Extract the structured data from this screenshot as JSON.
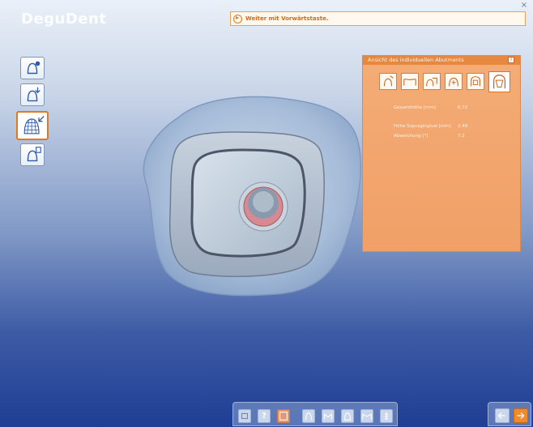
{
  "app": {
    "logo": "DeguDent"
  },
  "hint": {
    "text": "Weiter mit Vorwärtstaste."
  },
  "left_tools": [
    {
      "icon": "crown-info-icon"
    },
    {
      "icon": "crown-down-icon"
    },
    {
      "icon": "crown-mesh-icon",
      "active": true
    },
    {
      "icon": "crown-settings-icon"
    }
  ],
  "panel": {
    "title": "Ansicht des individuellen Abutments",
    "help": "?",
    "views": [
      {
        "icon": "abutment-view-1-icon"
      },
      {
        "icon": "abutment-view-2-icon"
      },
      {
        "icon": "abutment-view-3-icon"
      },
      {
        "icon": "abutment-view-4-icon"
      },
      {
        "icon": "abutment-view-5-icon"
      },
      {
        "icon": "abutment-view-6-icon",
        "active": true
      }
    ],
    "measurements": [
      {
        "label": "Gesamthöhe [mm]",
        "value": "6.72"
      },
      {
        "label": "Höhe Supragingival [mm]",
        "value": "2.49"
      },
      {
        "label": "Abweichung [°]",
        "value": "7.2"
      }
    ]
  },
  "bottom_toolbar": [
    {
      "icon": "minimize-icon"
    },
    {
      "icon": "help-icon",
      "label": "?"
    },
    {
      "icon": "tooth-box-icon"
    },
    {
      "icon": "tooth-view-icon"
    },
    {
      "icon": "jaw-view-icon"
    },
    {
      "icon": "crown-view-icon"
    },
    {
      "icon": "bridge-view-icon"
    },
    {
      "icon": "implant-view-icon"
    }
  ],
  "colors": {
    "accent": "#f08a2e",
    "panel": "#f2a56e",
    "model": "#b9c8dc"
  }
}
